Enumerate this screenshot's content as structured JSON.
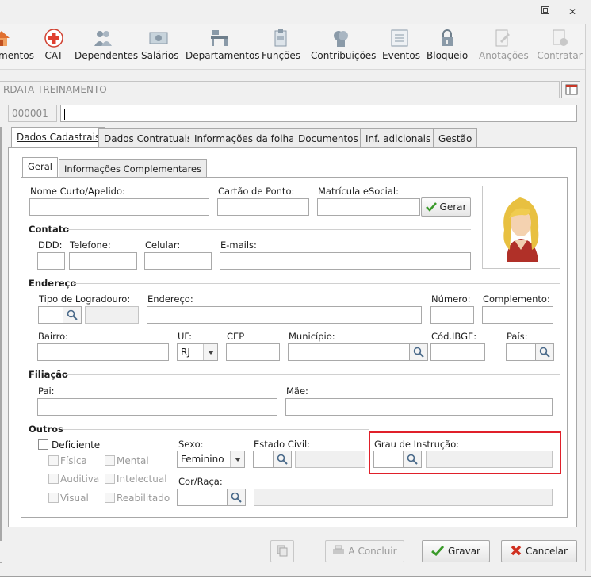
{
  "toolbar": {
    "items": [
      {
        "label": "mentos",
        "icon": "house-icon"
      },
      {
        "label": "CAT",
        "icon": "red-cross-icon"
      },
      {
        "label": "Dependentes",
        "icon": "people-icon"
      },
      {
        "label": "Salários",
        "icon": "money-icon"
      },
      {
        "label": "Departamentos",
        "icon": "desk-icon"
      },
      {
        "label": "Funções",
        "icon": "clipboard-icon"
      },
      {
        "label": "Contribuições",
        "icon": "heads-icon"
      },
      {
        "label": "Eventos",
        "icon": "list-icon"
      },
      {
        "label": "Bloqueio",
        "icon": "lock-icon"
      },
      {
        "label": "Anotações",
        "icon": "notes-icon"
      },
      {
        "label": "Contratar",
        "icon": "contract-icon"
      }
    ]
  },
  "company": {
    "name": "RDATA TREINAMENTO"
  },
  "employee": {
    "code": "000001",
    "name": ""
  },
  "tabs": [
    "Dados Cadastrais",
    "Dados Contratuais",
    "Informações da folha",
    "Documentos",
    "Inf. adicionais",
    "Gestão"
  ],
  "subtabs": [
    "Geral",
    "Informações Complementares"
  ],
  "form": {
    "nome_curto_label": "Nome Curto/Apelido:",
    "cartao_label": "Cartão de Ponto:",
    "matricula_label": "Matrícula eSocial:",
    "gerar_label": "Gerar",
    "contato_section": "Contato",
    "ddd_label": "DDD:",
    "telefone_label": "Telefone:",
    "celular_label": "Celular:",
    "emails_label": "E-mails:",
    "endereco_section": "Endereço",
    "tipo_logradouro_label": "Tipo de Logradouro:",
    "endereco_label": "Endereço:",
    "numero_label": "Número:",
    "complemento_label": "Complemento:",
    "bairro_label": "Bairro:",
    "uf_label": "UF:",
    "uf_value": "RJ",
    "cep_label": "CEP",
    "municipio_label": "Município:",
    "cod_ibge_label": "Cód.IBGE:",
    "pais_label": "País:",
    "filiacao_section": "Filiação",
    "pai_label": "Pai:",
    "mae_label": "Mãe:",
    "outros_section": "Outros",
    "deficiente_label": "Deficiente",
    "fisica_label": "Física",
    "mental_label": "Mental",
    "auditiva_label": "Auditiva",
    "intelectual_label": "Intelectual",
    "visual_label": "Visual",
    "reabilitado_label": "Reabilitado",
    "sexo_label": "Sexo:",
    "sexo_value": "Feminino",
    "estado_civil_label": "Estado Civil:",
    "grau_instrucao_label": "Grau de Instrução:",
    "cor_raca_label": "Cor/Raça:"
  },
  "footer": {
    "concluir_label": "A Concluir",
    "gravar_label": "Gravar",
    "cancelar_label": "Cancelar"
  },
  "colors": {
    "highlight": "#e0202a",
    "accent_green": "#3a9a2a",
    "cancel_red": "#d03020"
  }
}
